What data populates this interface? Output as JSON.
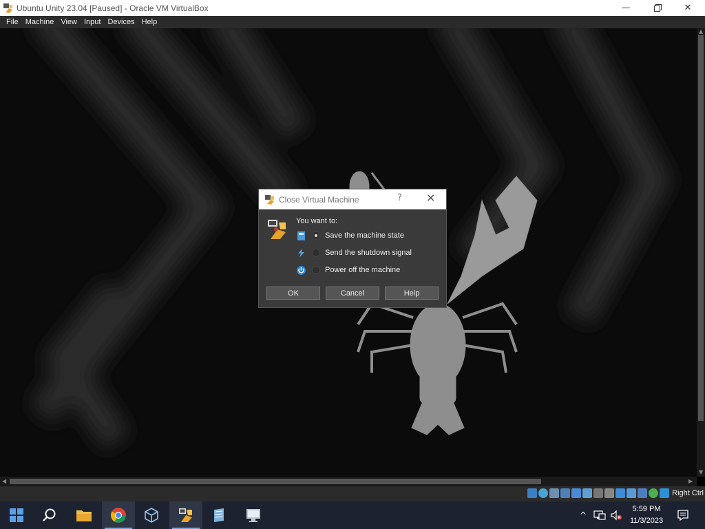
{
  "window": {
    "title": "Ubuntu Unity 23.04 [Paused] - Oracle VM VirtualBox",
    "minimize_icon": "minimize-icon",
    "maximize_icon": "restore-icon",
    "close_icon": "close-icon"
  },
  "menubar": {
    "items": [
      "File",
      "Machine",
      "View",
      "Input",
      "Devices",
      "Help"
    ]
  },
  "dialog": {
    "title": "Close Virtual Machine",
    "help_glyph": "?",
    "close_glyph": "✕",
    "prompt": "You want to:",
    "options": [
      {
        "label": "Save the machine state",
        "selected": true,
        "icon": "save-state-icon"
      },
      {
        "label": "Send the shutdown signal",
        "selected": false,
        "icon": "shutdown-signal-icon"
      },
      {
        "label": "Power off the machine",
        "selected": false,
        "icon": "power-icon"
      }
    ],
    "buttons": {
      "ok": "OK",
      "cancel": "Cancel",
      "help": "Help"
    }
  },
  "statusbar": {
    "host_key": "Right Ctrl"
  },
  "taskbar": {
    "time": "5:59 PM",
    "date": "11/3/2023"
  },
  "colors": {
    "dialog_bg": "#3a3a3a",
    "taskbar_bg": "#1c2230",
    "accent": "#7aa0d8"
  }
}
